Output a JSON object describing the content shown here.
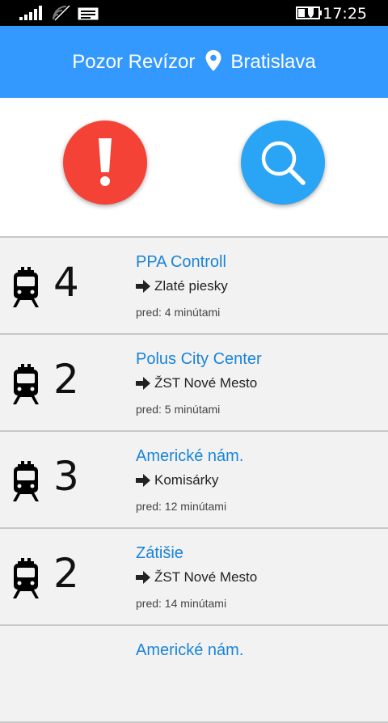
{
  "status_bar": {
    "time": "17:25",
    "icons": [
      "signal-icon",
      "wifi-icon",
      "message-icon",
      "battery-icon"
    ]
  },
  "app_bar": {
    "title": "Pozor Revízor",
    "city": "Bratislava",
    "icon": "location-pin-icon",
    "color": "#3399ff"
  },
  "actions": {
    "report": {
      "icon": "exclamation-icon",
      "color": "#f44336"
    },
    "search": {
      "icon": "search-icon",
      "color": "#2aa4f4"
    }
  },
  "reports": [
    {
      "count": "4",
      "stop": "PPA Controll",
      "direction": "Zlaté piesky",
      "ago": "pred: 4 minútami"
    },
    {
      "count": "2",
      "stop": "Polus City Center",
      "direction": "ŽST Nové Mesto",
      "ago": "pred: 5 minútami"
    },
    {
      "count": "3",
      "stop": "Americké nám.",
      "direction": "Komisárky",
      "ago": "pred: 12 minútami"
    },
    {
      "count": "2",
      "stop": "Zátišie",
      "direction": "ŽST Nové Mesto",
      "ago": "pred: 14 minútami"
    },
    {
      "count": "",
      "stop": "Americké nám.",
      "direction": "",
      "ago": ""
    }
  ],
  "accent_link_color": "#1a84d8"
}
